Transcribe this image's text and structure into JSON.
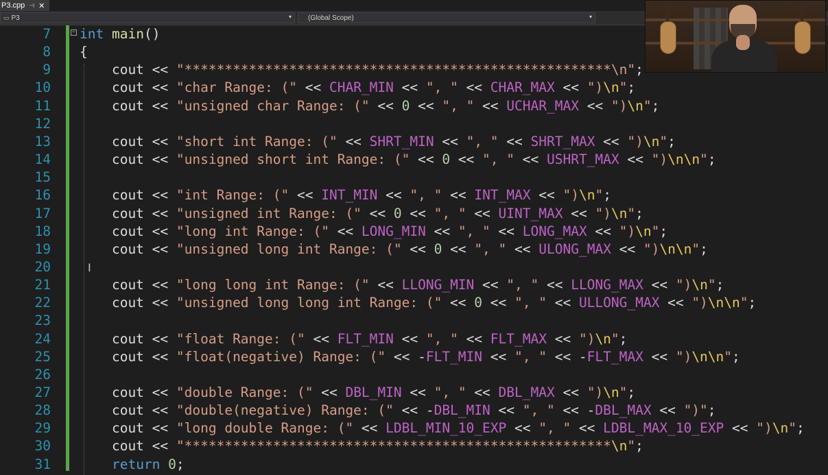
{
  "tab": {
    "title": "P3.cpp",
    "pin_icon": "pin-icon",
    "close_icon": "close-icon"
  },
  "navbar": {
    "project": "P3",
    "scope": "(Global Scope)"
  },
  "lines": [
    {
      "n": "7",
      "tokens": [
        [
          "kw",
          "int"
        ],
        [
          "op",
          " "
        ],
        [
          "fn",
          "main"
        ],
        [
          "op",
          "()"
        ]
      ]
    },
    {
      "n": "8",
      "tokens": [
        [
          "op",
          "{"
        ]
      ]
    },
    {
      "n": "9",
      "tokens": [
        [
          "op",
          "    cout << "
        ],
        [
          "str",
          "\"*****************************************************\\n\""
        ],
        [
          "op",
          ";"
        ]
      ]
    },
    {
      "n": "10",
      "tokens": [
        [
          "op",
          "    cout << "
        ],
        [
          "str",
          "\"char Range: (\""
        ],
        [
          "op",
          " << "
        ],
        [
          "mac",
          "CHAR_MIN"
        ],
        [
          "op",
          " << "
        ],
        [
          "str",
          "\", \""
        ],
        [
          "op",
          " << "
        ],
        [
          "mac",
          "CHAR_MAX"
        ],
        [
          "op",
          " << "
        ],
        [
          "str",
          "\")"
        ],
        [
          "esc",
          "\\n"
        ],
        [
          "str",
          "\""
        ],
        [
          "op",
          ";"
        ]
      ]
    },
    {
      "n": "11",
      "tokens": [
        [
          "op",
          "    cout << "
        ],
        [
          "str",
          "\"unsigned char Range: (\""
        ],
        [
          "op",
          " << "
        ],
        [
          "num",
          "0"
        ],
        [
          "op",
          " << "
        ],
        [
          "str",
          "\", \""
        ],
        [
          "op",
          " << "
        ],
        [
          "mac",
          "UCHAR_MAX"
        ],
        [
          "op",
          " << "
        ],
        [
          "str",
          "\")"
        ],
        [
          "esc",
          "\\n"
        ],
        [
          "str",
          "\""
        ],
        [
          "op",
          ";"
        ]
      ]
    },
    {
      "n": "12",
      "tokens": []
    },
    {
      "n": "13",
      "tokens": [
        [
          "op",
          "    cout << "
        ],
        [
          "str",
          "\"short int Range: (\""
        ],
        [
          "op",
          " << "
        ],
        [
          "mac",
          "SHRT_MIN"
        ],
        [
          "op",
          " << "
        ],
        [
          "str",
          "\", \""
        ],
        [
          "op",
          " << "
        ],
        [
          "mac",
          "SHRT_MAX"
        ],
        [
          "op",
          " << "
        ],
        [
          "str",
          "\")"
        ],
        [
          "esc",
          "\\n"
        ],
        [
          "str",
          "\""
        ],
        [
          "op",
          ";"
        ]
      ]
    },
    {
      "n": "14",
      "tokens": [
        [
          "op",
          "    cout << "
        ],
        [
          "str",
          "\"unsigned short int Range: (\""
        ],
        [
          "op",
          " << "
        ],
        [
          "num",
          "0"
        ],
        [
          "op",
          " << "
        ],
        [
          "str",
          "\", \""
        ],
        [
          "op",
          " << "
        ],
        [
          "mac",
          "USHRT_MAX"
        ],
        [
          "op",
          " << "
        ],
        [
          "str",
          "\")"
        ],
        [
          "esc",
          "\\n\\n"
        ],
        [
          "str",
          "\""
        ],
        [
          "op",
          ";"
        ]
      ]
    },
    {
      "n": "15",
      "tokens": []
    },
    {
      "n": "16",
      "tokens": [
        [
          "op",
          "    cout << "
        ],
        [
          "str",
          "\"int Range: (\""
        ],
        [
          "op",
          " << "
        ],
        [
          "mac",
          "INT_MIN"
        ],
        [
          "op",
          " << "
        ],
        [
          "str",
          "\", \""
        ],
        [
          "op",
          " << "
        ],
        [
          "mac",
          "INT_MAX"
        ],
        [
          "op",
          " << "
        ],
        [
          "str",
          "\")"
        ],
        [
          "esc",
          "\\n"
        ],
        [
          "str",
          "\""
        ],
        [
          "op",
          ";"
        ]
      ]
    },
    {
      "n": "17",
      "tokens": [
        [
          "op",
          "    cout << "
        ],
        [
          "str",
          "\"unsigned int Range: (\""
        ],
        [
          "op",
          " << "
        ],
        [
          "num",
          "0"
        ],
        [
          "op",
          " << "
        ],
        [
          "str",
          "\", \""
        ],
        [
          "op",
          " << "
        ],
        [
          "mac",
          "UINT_MAX"
        ],
        [
          "op",
          " << "
        ],
        [
          "str",
          "\")"
        ],
        [
          "esc",
          "\\n"
        ],
        [
          "str",
          "\""
        ],
        [
          "op",
          ";"
        ]
      ]
    },
    {
      "n": "18",
      "tokens": [
        [
          "op",
          "    cout << "
        ],
        [
          "str",
          "\"long int Range: (\""
        ],
        [
          "op",
          " << "
        ],
        [
          "mac",
          "LONG_MIN"
        ],
        [
          "op",
          " << "
        ],
        [
          "str",
          "\", \""
        ],
        [
          "op",
          " << "
        ],
        [
          "mac",
          "LONG_MAX"
        ],
        [
          "op",
          " << "
        ],
        [
          "str",
          "\")"
        ],
        [
          "esc",
          "\\n"
        ],
        [
          "str",
          "\""
        ],
        [
          "op",
          ";"
        ]
      ]
    },
    {
      "n": "19",
      "tokens": [
        [
          "op",
          "    cout << "
        ],
        [
          "str",
          "\"unsigned long int Range: (\""
        ],
        [
          "op",
          " << "
        ],
        [
          "num",
          "0"
        ],
        [
          "op",
          " << "
        ],
        [
          "str",
          "\", \""
        ],
        [
          "op",
          " << "
        ],
        [
          "mac",
          "ULONG_MAX"
        ],
        [
          "op",
          " << "
        ],
        [
          "str",
          "\")"
        ],
        [
          "esc",
          "\\n\\n"
        ],
        [
          "str",
          "\""
        ],
        [
          "op",
          ";"
        ]
      ]
    },
    {
      "n": "20",
      "tokens": []
    },
    {
      "n": "21",
      "tokens": [
        [
          "op",
          "    cout << "
        ],
        [
          "str",
          "\"long long int Range: (\""
        ],
        [
          "op",
          " << "
        ],
        [
          "mac",
          "LLONG_MIN"
        ],
        [
          "op",
          " << "
        ],
        [
          "str",
          "\", \""
        ],
        [
          "op",
          " << "
        ],
        [
          "mac",
          "LLONG_MAX"
        ],
        [
          "op",
          " << "
        ],
        [
          "str",
          "\")"
        ],
        [
          "esc",
          "\\n"
        ],
        [
          "str",
          "\""
        ],
        [
          "op",
          ";"
        ]
      ]
    },
    {
      "n": "22",
      "tokens": [
        [
          "op",
          "    cout << "
        ],
        [
          "str",
          "\"unsigned long long int Range: (\""
        ],
        [
          "op",
          " << "
        ],
        [
          "num",
          "0"
        ],
        [
          "op",
          " << "
        ],
        [
          "str",
          "\", \""
        ],
        [
          "op",
          " << "
        ],
        [
          "mac",
          "ULLONG_MAX"
        ],
        [
          "op",
          " << "
        ],
        [
          "str",
          "\")"
        ],
        [
          "esc",
          "\\n\\n"
        ],
        [
          "str",
          "\""
        ],
        [
          "op",
          ";"
        ]
      ]
    },
    {
      "n": "23",
      "tokens": []
    },
    {
      "n": "24",
      "tokens": [
        [
          "op",
          "    cout << "
        ],
        [
          "str",
          "\"float Range: (\""
        ],
        [
          "op",
          " << "
        ],
        [
          "mac",
          "FLT_MIN"
        ],
        [
          "op",
          " << "
        ],
        [
          "str",
          "\", \""
        ],
        [
          "op",
          " << "
        ],
        [
          "mac",
          "FLT_MAX"
        ],
        [
          "op",
          " << "
        ],
        [
          "str",
          "\")"
        ],
        [
          "esc",
          "\\n"
        ],
        [
          "str",
          "\""
        ],
        [
          "op",
          ";"
        ]
      ]
    },
    {
      "n": "25",
      "tokens": [
        [
          "op",
          "    cout << "
        ],
        [
          "str",
          "\"float(negative) Range: (\""
        ],
        [
          "op",
          " << -"
        ],
        [
          "mac",
          "FLT_MIN"
        ],
        [
          "op",
          " << "
        ],
        [
          "str",
          "\", \""
        ],
        [
          "op",
          " << -"
        ],
        [
          "mac",
          "FLT_MAX"
        ],
        [
          "op",
          " << "
        ],
        [
          "str",
          "\")"
        ],
        [
          "esc",
          "\\n\\n"
        ],
        [
          "str",
          "\""
        ],
        [
          "op",
          ";"
        ]
      ]
    },
    {
      "n": "26",
      "tokens": []
    },
    {
      "n": "27",
      "tokens": [
        [
          "op",
          "    cout << "
        ],
        [
          "str",
          "\"double Range: (\""
        ],
        [
          "op",
          " << "
        ],
        [
          "mac",
          "DBL_MIN"
        ],
        [
          "op",
          " << "
        ],
        [
          "str",
          "\", \""
        ],
        [
          "op",
          " << "
        ],
        [
          "mac",
          "DBL_MAX"
        ],
        [
          "op",
          " << "
        ],
        [
          "str",
          "\")"
        ],
        [
          "esc",
          "\\n"
        ],
        [
          "str",
          "\""
        ],
        [
          "op",
          ";"
        ]
      ]
    },
    {
      "n": "28",
      "tokens": [
        [
          "op",
          "    cout << "
        ],
        [
          "str",
          "\"double(negative) Range: (\""
        ],
        [
          "op",
          " << -"
        ],
        [
          "mac",
          "DBL_MIN"
        ],
        [
          "op",
          " << "
        ],
        [
          "str",
          "\", \""
        ],
        [
          "op",
          " << -"
        ],
        [
          "mac",
          "DBL_MAX"
        ],
        [
          "op",
          " << "
        ],
        [
          "str",
          "\")\""
        ],
        [
          "op",
          ";"
        ]
      ]
    },
    {
      "n": "29",
      "tokens": [
        [
          "op",
          "    cout << "
        ],
        [
          "str",
          "\"long double Range: (\""
        ],
        [
          "op",
          " << "
        ],
        [
          "mac",
          "LDBL_MIN_10_EXP"
        ],
        [
          "op",
          " << "
        ],
        [
          "str",
          "\", \""
        ],
        [
          "op",
          " << "
        ],
        [
          "mac",
          "LDBL_MAX_10_EXP"
        ],
        [
          "op",
          " << "
        ],
        [
          "str",
          "\")"
        ],
        [
          "esc",
          "\\n"
        ],
        [
          "str",
          "\""
        ],
        [
          "op",
          ";"
        ]
      ]
    },
    {
      "n": "30",
      "tokens": [
        [
          "op",
          "    cout << "
        ],
        [
          "str",
          "\"*****************************************************"
        ],
        [
          "esc",
          "\\n"
        ],
        [
          "str",
          "\""
        ],
        [
          "op",
          ";"
        ]
      ]
    },
    {
      "n": "31",
      "tokens": [
        [
          "op",
          "    "
        ],
        [
          "kw",
          "return"
        ],
        [
          "op",
          " "
        ],
        [
          "num",
          "0"
        ],
        [
          "op",
          ";"
        ]
      ]
    }
  ],
  "icons": {
    "fold": "collapse-icon",
    "text_cursor": "ibeam-cursor-icon",
    "dropdown": "chevron-down-icon"
  }
}
